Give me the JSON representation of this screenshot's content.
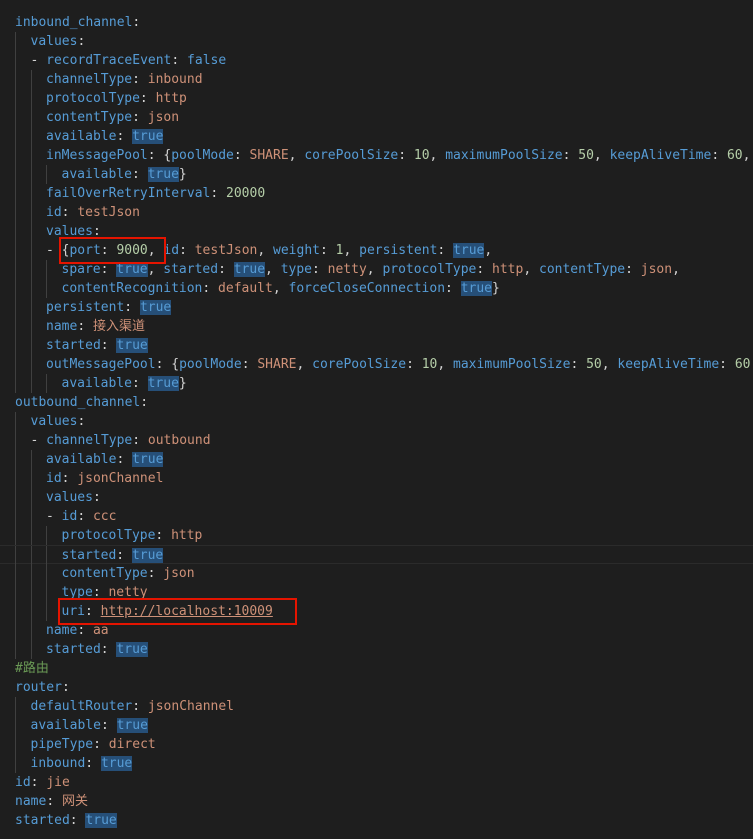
{
  "editor": {
    "language": "yaml",
    "colors": {
      "background": "#1e1e1e",
      "key": "#569cd6",
      "string": "#ce9178",
      "number": "#b5cea8",
      "boolean_highlight": "#264f78",
      "comment": "#6a9955",
      "annotation_box": "#e51400"
    },
    "lines": [
      [
        [
          "key",
          "inbound_channel"
        ],
        [
          "punc",
          ":"
        ]
      ],
      [
        [
          "key",
          "values"
        ],
        [
          "punc",
          ":"
        ]
      ],
      [
        [
          "punc",
          "- "
        ],
        [
          "key",
          "recordTraceEvent"
        ],
        [
          "punc",
          ": "
        ],
        [
          "kw",
          "false"
        ]
      ],
      [
        [
          "key",
          "channelType"
        ],
        [
          "punc",
          ": "
        ],
        [
          "str",
          "inbound"
        ]
      ],
      [
        [
          "key",
          "protocolType"
        ],
        [
          "punc",
          ": "
        ],
        [
          "str",
          "http"
        ]
      ],
      [
        [
          "key",
          "contentType"
        ],
        [
          "punc",
          ": "
        ],
        [
          "str",
          "json"
        ]
      ],
      [
        [
          "key",
          "available"
        ],
        [
          "punc",
          ": "
        ],
        [
          "bool",
          "true"
        ]
      ],
      [
        [
          "key",
          "inMessagePool"
        ],
        [
          "punc",
          ": {"
        ],
        [
          "key",
          "poolMode"
        ],
        [
          "punc",
          ": "
        ],
        [
          "str",
          "SHARE"
        ],
        [
          "punc",
          ", "
        ],
        [
          "key",
          "corePoolSize"
        ],
        [
          "punc",
          ": "
        ],
        [
          "num",
          "10"
        ],
        [
          "punc",
          ", "
        ],
        [
          "key",
          "maximumPoolSize"
        ],
        [
          "punc",
          ": "
        ],
        [
          "num",
          "50"
        ],
        [
          "punc",
          ", "
        ],
        [
          "key",
          "keepAliveTime"
        ],
        [
          "punc",
          ": "
        ],
        [
          "num",
          "60"
        ],
        [
          "punc",
          ","
        ]
      ],
      [
        [
          "key",
          "available"
        ],
        [
          "punc",
          ": "
        ],
        [
          "bool",
          "true"
        ],
        [
          "punc",
          "}"
        ]
      ],
      [
        [
          "key",
          "failOverRetryInterval"
        ],
        [
          "punc",
          ": "
        ],
        [
          "num",
          "20000"
        ]
      ],
      [
        [
          "key",
          "id"
        ],
        [
          "punc",
          ": "
        ],
        [
          "str",
          "testJson"
        ]
      ],
      [
        [
          "key",
          "values"
        ],
        [
          "punc",
          ":"
        ]
      ],
      [
        [
          "punc",
          "- {"
        ],
        [
          "key",
          "port"
        ],
        [
          "punc",
          ": "
        ],
        [
          "num",
          "9000"
        ],
        [
          "punc",
          ", "
        ],
        [
          "key",
          "id"
        ],
        [
          "punc",
          ": "
        ],
        [
          "str",
          "testJson"
        ],
        [
          "punc",
          ", "
        ],
        [
          "key",
          "weight"
        ],
        [
          "punc",
          ": "
        ],
        [
          "num",
          "1"
        ],
        [
          "punc",
          ", "
        ],
        [
          "key",
          "persistent"
        ],
        [
          "punc",
          ": "
        ],
        [
          "bool",
          "true"
        ],
        [
          "punc",
          ","
        ]
      ],
      [
        [
          "key",
          "spare"
        ],
        [
          "punc",
          ": "
        ],
        [
          "bool",
          "true"
        ],
        [
          "punc",
          ", "
        ],
        [
          "key",
          "started"
        ],
        [
          "punc",
          ": "
        ],
        [
          "bool",
          "true"
        ],
        [
          "punc",
          ", "
        ],
        [
          "key",
          "type"
        ],
        [
          "punc",
          ": "
        ],
        [
          "str",
          "netty"
        ],
        [
          "punc",
          ", "
        ],
        [
          "key",
          "protocolType"
        ],
        [
          "punc",
          ": "
        ],
        [
          "str",
          "http"
        ],
        [
          "punc",
          ", "
        ],
        [
          "key",
          "contentType"
        ],
        [
          "punc",
          ": "
        ],
        [
          "str",
          "json"
        ],
        [
          "punc",
          ","
        ]
      ],
      [
        [
          "key",
          "contentRecognition"
        ],
        [
          "punc",
          ": "
        ],
        [
          "str",
          "default"
        ],
        [
          "punc",
          ", "
        ],
        [
          "key",
          "forceCloseConnection"
        ],
        [
          "punc",
          ": "
        ],
        [
          "bool",
          "true"
        ],
        [
          "punc",
          "}"
        ]
      ],
      [
        [
          "key",
          "persistent"
        ],
        [
          "punc",
          ": "
        ],
        [
          "bool",
          "true"
        ]
      ],
      [
        [
          "key",
          "name"
        ],
        [
          "punc",
          ": "
        ],
        [
          "str",
          "接入渠道"
        ]
      ],
      [
        [
          "key",
          "started"
        ],
        [
          "punc",
          ": "
        ],
        [
          "bool",
          "true"
        ]
      ],
      [
        [
          "key",
          "outMessagePool"
        ],
        [
          "punc",
          ": {"
        ],
        [
          "key",
          "poolMode"
        ],
        [
          "punc",
          ": "
        ],
        [
          "str",
          "SHARE"
        ],
        [
          "punc",
          ", "
        ],
        [
          "key",
          "corePoolSize"
        ],
        [
          "punc",
          ": "
        ],
        [
          "num",
          "10"
        ],
        [
          "punc",
          ", "
        ],
        [
          "key",
          "maximumPoolSize"
        ],
        [
          "punc",
          ": "
        ],
        [
          "num",
          "50"
        ],
        [
          "punc",
          ", "
        ],
        [
          "key",
          "keepAliveTime"
        ],
        [
          "punc",
          ": "
        ],
        [
          "num",
          "60"
        ],
        [
          "punc",
          ","
        ]
      ],
      [
        [
          "key",
          "available"
        ],
        [
          "punc",
          ": "
        ],
        [
          "bool",
          "true"
        ],
        [
          "punc",
          "}"
        ]
      ],
      [
        [
          "key",
          "outbound_channel"
        ],
        [
          "punc",
          ":"
        ]
      ],
      [
        [
          "key",
          "values"
        ],
        [
          "punc",
          ":"
        ]
      ],
      [
        [
          "punc",
          "- "
        ],
        [
          "key",
          "channelType"
        ],
        [
          "punc",
          ": "
        ],
        [
          "str",
          "outbound"
        ]
      ],
      [
        [
          "key",
          "available"
        ],
        [
          "punc",
          ": "
        ],
        [
          "bool",
          "true"
        ]
      ],
      [
        [
          "key",
          "id"
        ],
        [
          "punc",
          ": "
        ],
        [
          "str",
          "jsonChannel"
        ]
      ],
      [
        [
          "key",
          "values"
        ],
        [
          "punc",
          ":"
        ]
      ],
      [
        [
          "punc",
          "- "
        ],
        [
          "key",
          "id"
        ],
        [
          "punc",
          ": "
        ],
        [
          "str",
          "ccc"
        ]
      ],
      [
        [
          "key",
          "protocolType"
        ],
        [
          "punc",
          ": "
        ],
        [
          "str",
          "http"
        ]
      ],
      [
        [
          "key",
          "started"
        ],
        [
          "punc",
          ": "
        ],
        [
          "bool",
          "true"
        ]
      ],
      [
        [
          "key",
          "contentType"
        ],
        [
          "punc",
          ": "
        ],
        [
          "str",
          "json"
        ]
      ],
      [
        [
          "key",
          "type"
        ],
        [
          "punc",
          ": "
        ],
        [
          "str",
          "netty"
        ]
      ],
      [
        [
          "key",
          "uri"
        ],
        [
          "punc",
          ": "
        ],
        [
          "link",
          "http://localhost:10009"
        ]
      ],
      [
        [
          "key",
          "name"
        ],
        [
          "punc",
          ": "
        ],
        [
          "str",
          "aa"
        ]
      ],
      [
        [
          "key",
          "started"
        ],
        [
          "punc",
          ": "
        ],
        [
          "bool",
          "true"
        ]
      ],
      [
        [
          "cmt",
          "#路由"
        ]
      ],
      [
        [
          "key",
          "router"
        ],
        [
          "punc",
          ":"
        ]
      ],
      [
        [
          "key",
          "defaultRouter"
        ],
        [
          "punc",
          ": "
        ],
        [
          "str",
          "jsonChannel"
        ]
      ],
      [
        [
          "key",
          "available"
        ],
        [
          "punc",
          ": "
        ],
        [
          "bool",
          "true"
        ]
      ],
      [
        [
          "key",
          "pipeType"
        ],
        [
          "punc",
          ": "
        ],
        [
          "str",
          "direct"
        ]
      ],
      [
        [
          "key",
          "inbound"
        ],
        [
          "punc",
          ": "
        ],
        [
          "bool",
          "true"
        ]
      ],
      [
        [
          "key",
          "id"
        ],
        [
          "punc",
          ": "
        ],
        [
          "str",
          "jie"
        ]
      ],
      [
        [
          "key",
          "name"
        ],
        [
          "punc",
          ": "
        ],
        [
          "str",
          "网关"
        ]
      ],
      [
        [
          "key",
          "started"
        ],
        [
          "punc",
          ": "
        ],
        [
          "bool",
          "true"
        ]
      ]
    ]
  }
}
